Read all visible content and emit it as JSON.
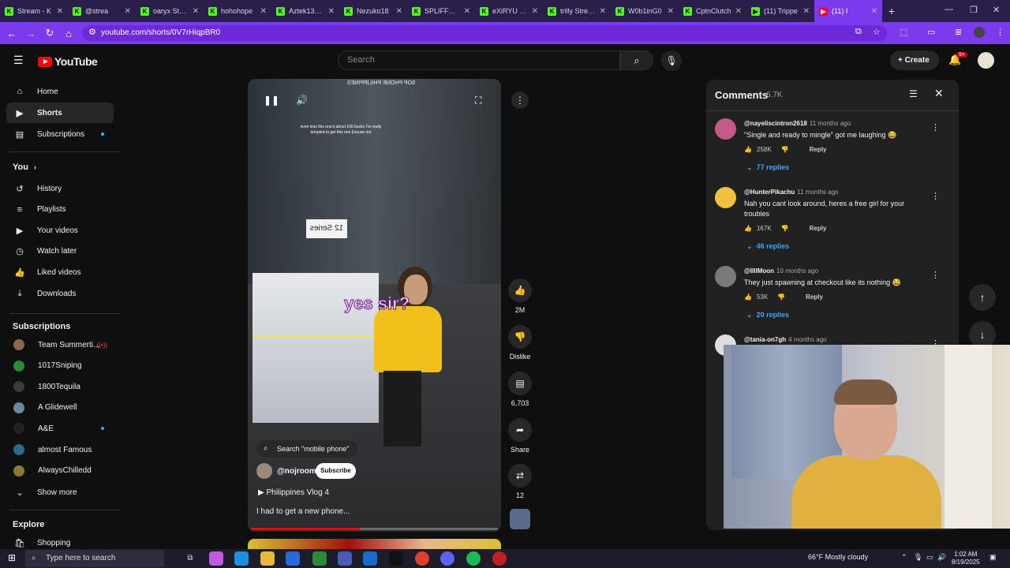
{
  "browser": {
    "tabs": [
      {
        "title": "Stream - K",
        "favicon": "K"
      },
      {
        "title": "@strea",
        "favicon": "K"
      },
      {
        "title": "oaryx Strea",
        "favicon": "K"
      },
      {
        "title": "hohohope",
        "favicon": "K"
      },
      {
        "title": "Aztek138 S",
        "favicon": "K"
      },
      {
        "title": "Nezuko18",
        "favicon": "K"
      },
      {
        "title": "SPLIFFMO",
        "favicon": "K"
      },
      {
        "title": "eXiRYU Str",
        "favicon": "K"
      },
      {
        "title": "trilly Stream",
        "favicon": "K"
      },
      {
        "title": "W0b1inG0",
        "favicon": "K"
      },
      {
        "title": "CptnClutch",
        "favicon": "K"
      },
      {
        "title": "(11) Trippe",
        "favicon": "▶"
      },
      {
        "title": "(11) I",
        "favicon": "▶",
        "active": true
      }
    ],
    "new_tab": "+",
    "url": "youtube.com/shorts/0V7rHiqpBR0",
    "window_controls": {
      "minimize": "—",
      "restore": "❐",
      "close": "✕"
    }
  },
  "youtube": {
    "logo_text": "YouTube",
    "search_placeholder": "Search",
    "create_label": "Create",
    "notification_badge": "9+",
    "sidebar": {
      "main": [
        {
          "label": "Home",
          "icon": "⌂"
        },
        {
          "label": "Shorts",
          "icon": "▶",
          "active": true
        },
        {
          "label": "Subscriptions",
          "icon": "▤"
        }
      ],
      "you_heading": "You",
      "you_items": [
        {
          "label": "History",
          "icon": "↺"
        },
        {
          "label": "Playlists",
          "icon": "≡"
        },
        {
          "label": "Your videos",
          "icon": "▶"
        },
        {
          "label": "Watch later",
          "icon": "◷"
        },
        {
          "label": "Liked videos",
          "icon": "👍"
        },
        {
          "label": "Downloads",
          "icon": "⤓"
        }
      ],
      "subscriptions_heading": "Subscriptions",
      "subscriptions": [
        {
          "label": "Team Summerti...",
          "color": "#8a6a4a",
          "live": true
        },
        {
          "label": "1017Sniping",
          "color": "#2a8a3a"
        },
        {
          "label": "1800Tequila",
          "color": "#3a3a3a"
        },
        {
          "label": "A Glidewell",
          "color": "#6a8a9a"
        },
        {
          "label": "A&E",
          "color": "#222222",
          "dot": true
        },
        {
          "label": "almost Famous",
          "color": "#2a6a8a"
        },
        {
          "label": "AlwaysChilledd",
          "color": "#8a7a3a"
        }
      ],
      "show_more": "Show more",
      "explore_heading": "Explore",
      "explore_items": [
        {
          "label": "Shopping",
          "icon": "🛍"
        }
      ]
    },
    "video": {
      "caption_small": "even less this one's about 100 bucks I'm really tempted to get this one Excuse me",
      "caption_big": "yes sir?",
      "sign_text": "12 Series",
      "top_sign": "SOP PHONE PHILIPPINES",
      "search_chip": "Search \"mobile phone\"",
      "channel": "@nojroom",
      "subscribe_label": "Subscribe",
      "playlist": "Philippines Vlog 4",
      "title": "I had to get a new phone...",
      "progress": 0.44
    },
    "actions": {
      "likes": "2M",
      "dislike": "Dislike",
      "comments": "6,703",
      "share": "Share",
      "remix": "12"
    },
    "comments": {
      "title": "Comments",
      "count": "6.7K",
      "items": [
        {
          "user": "@nayeliscintron2618",
          "time": "11 months ago",
          "text": "\"Single and ready to mingle\" got me laughing 😂",
          "likes": "258K",
          "replies": "77 replies",
          "avatar_color": "#c45a8a"
        },
        {
          "user": "@HunterPikachu",
          "time": "11 months ago",
          "text": "Nah you cant look around, heres a free girl for your troubles",
          "likes": "167K",
          "replies": "46 replies",
          "avatar_color": "#f0c040"
        },
        {
          "user": "@IIIIMoon",
          "time": "10 months ago",
          "text": "They just spawning at checkout like its nothing 😂",
          "likes": "53K",
          "replies": "20 replies",
          "avatar_color": "#7a7a7a"
        },
        {
          "user": "@tania-on7gh",
          "time": "4 months ago",
          "text": "",
          "likes": "",
          "replies": "",
          "avatar_color": "#dddddd"
        }
      ],
      "reply_label": "Reply"
    }
  },
  "taskbar": {
    "search_placeholder": "Type here to search",
    "weather": "66°F  Mostly cloudy",
    "time": "1:02 AM",
    "date": "8/19/2025"
  }
}
